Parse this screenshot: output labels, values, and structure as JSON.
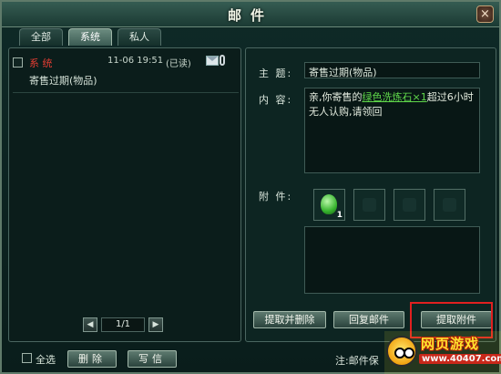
{
  "window": {
    "title": "邮件",
    "close_label": "×"
  },
  "tabs": [
    {
      "label": "全部",
      "active": false
    },
    {
      "label": "系统",
      "active": true
    },
    {
      "label": "私人",
      "active": false
    }
  ],
  "mail_list": {
    "items": [
      {
        "sender": "系 统",
        "date": "11-06 19:51",
        "status": "(已读)",
        "subject": "寄售过期(物品)",
        "icons": [
          "envelope-icon",
          "attachment-clip-icon"
        ]
      }
    ],
    "pager": {
      "prev": "◀",
      "text": "1/1",
      "next": "▶"
    }
  },
  "detail": {
    "subject_label": "主  题:",
    "subject_value": "寄售过期(物品)",
    "content_label": "内  容:",
    "content_prefix": "亲,你寄售的",
    "content_link": "绿色洗炼石×1",
    "content_suffix": "超过6小时无人认购,请领回",
    "attachment_label": "附  件:",
    "attachments": [
      {
        "item": "green-gem-icon",
        "count": "1"
      },
      {
        "item": "",
        "count": ""
      },
      {
        "item": "",
        "count": ""
      },
      {
        "item": "",
        "count": ""
      }
    ],
    "buttons": {
      "extract_delete": "提取并删除",
      "reply": "回复邮件",
      "extract_attachment": "提取附件"
    }
  },
  "bottom": {
    "select_all": "全选",
    "delete": "删除",
    "write": "写信",
    "note": "注:邮件保"
  },
  "watermark": {
    "title": "网页游戏",
    "url": "www.40407.com"
  },
  "colors": {
    "sender_red": "#e33d33",
    "link_green": "#5fd74a",
    "highlight_red": "#e02020",
    "watermark_yellow": "#ffe32e"
  }
}
